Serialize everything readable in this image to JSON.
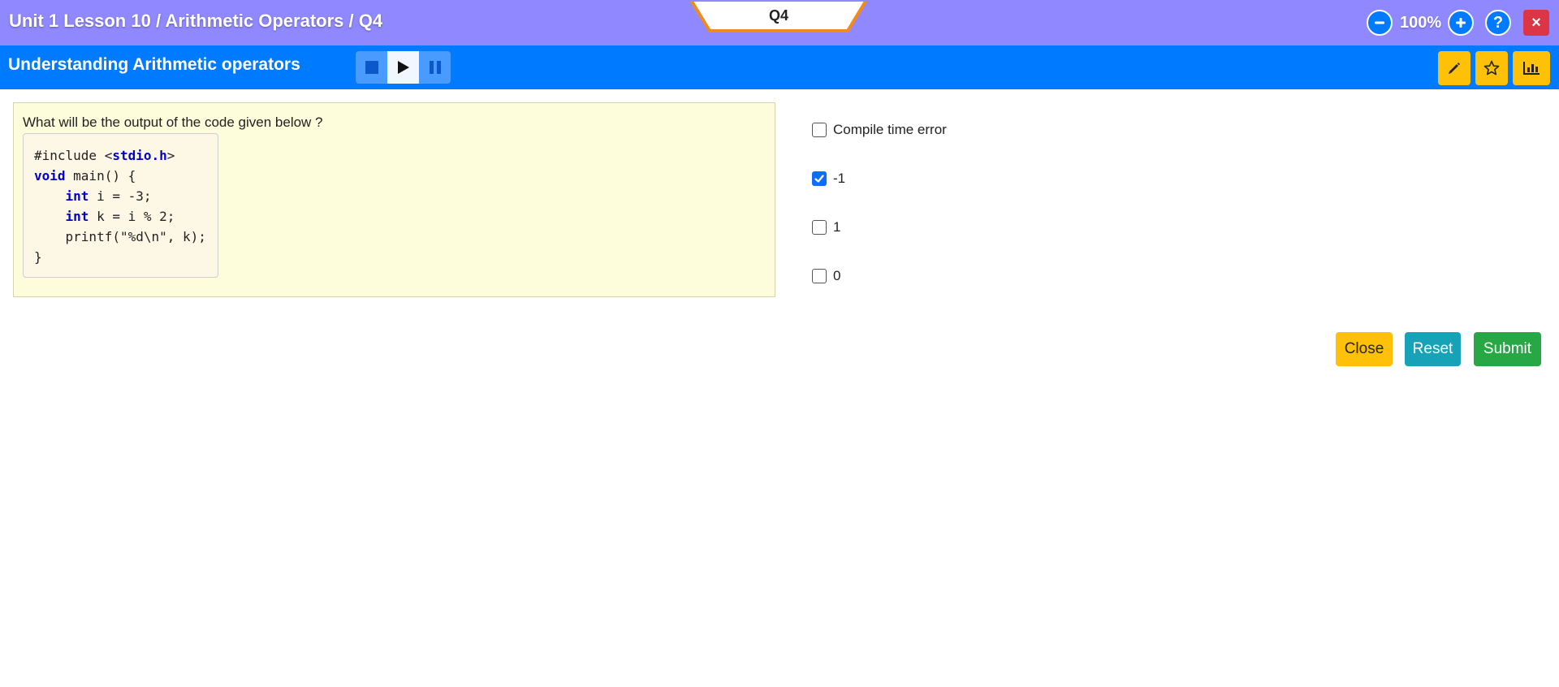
{
  "header": {
    "breadcrumb": "Unit 1 Lesson 10 / Arithmetic Operators / Q4",
    "question_tab": "Q4",
    "zoom_level": "100%",
    "zoom_out_icon": "minus-circle-icon",
    "zoom_in_icon": "plus-circle-icon",
    "help_label": "?",
    "close_label": "×"
  },
  "subheader": {
    "title": "Understanding Arithmetic operators",
    "media_controls": [
      "stop-icon",
      "play-icon",
      "pause-icon"
    ],
    "tools": [
      "pencil-icon",
      "star-icon",
      "bar-chart-icon"
    ]
  },
  "question": {
    "prompt": "What will be the output of the code given below ?",
    "code": {
      "line1_a": "#include <",
      "line1_b": "stdio.h",
      "line1_c": ">",
      "line2_kw": "void",
      "line2_rest": " main() {",
      "line3_kw": "int",
      "line3_rest": " i = -3;",
      "line4_kw": "int",
      "line4_rest": " k = i % 2;",
      "line5": "    printf(\"%d\\n\", k);",
      "line6": "}"
    }
  },
  "options": [
    {
      "label": "Compile time error",
      "checked": false
    },
    {
      "label": "-1",
      "checked": true
    },
    {
      "label": "1",
      "checked": false
    },
    {
      "label": "0",
      "checked": false
    }
  ],
  "actions": {
    "close": "Close",
    "reset": "Reset",
    "submit": "Submit"
  },
  "colors": {
    "topbar": "#9088ff",
    "subbar": "#007bff",
    "tab_border": "#f08a1c",
    "warning": "#ffc107",
    "info": "#17a2b8",
    "success": "#28a745",
    "danger": "#dc3545"
  }
}
